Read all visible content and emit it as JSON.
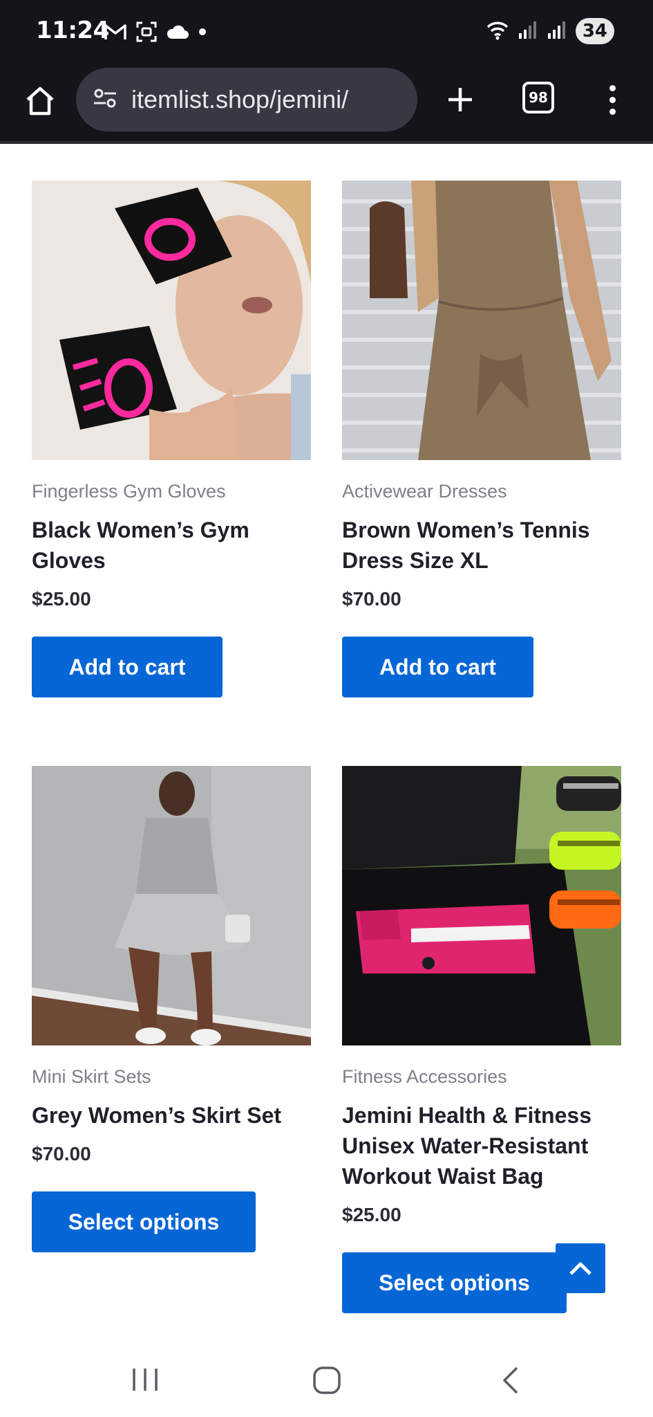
{
  "status_bar": {
    "time": "11:24",
    "battery": "34",
    "left_icons": [
      "gmail-icon",
      "screenshot-icon",
      "cloud-icon",
      "dot-icon"
    ],
    "right_icons": [
      "wifi-icon",
      "signal-icon",
      "signal-icon"
    ]
  },
  "browser": {
    "url": "itemlist.shop/jemini/",
    "tab_count": "98"
  },
  "products": [
    {
      "category": "Fingerless Gym Gloves",
      "title": "Black Women’s Gym Gloves",
      "price": "$25.00",
      "button": "Add to cart"
    },
    {
      "category": "Activewear Dresses",
      "title": "Brown Women’s Tennis Dress Size XL",
      "price": "$70.00",
      "button": "Add to cart"
    },
    {
      "category": "Mini Skirt Sets",
      "title": "Grey Women’s Skirt Set",
      "price": "$70.00",
      "button": "Select options"
    },
    {
      "category": "Fitness Accessories",
      "title": "Jemini Health & Fitness Unisex Water-Resistant Workout Waist Bag",
      "price": "$25.00",
      "button": "Select options"
    }
  ],
  "colors": {
    "accent": "#0766d6",
    "chrome": "#14151b",
    "url_bar": "#363843",
    "category_text": "#7d8087",
    "title_text": "#1f2129"
  }
}
